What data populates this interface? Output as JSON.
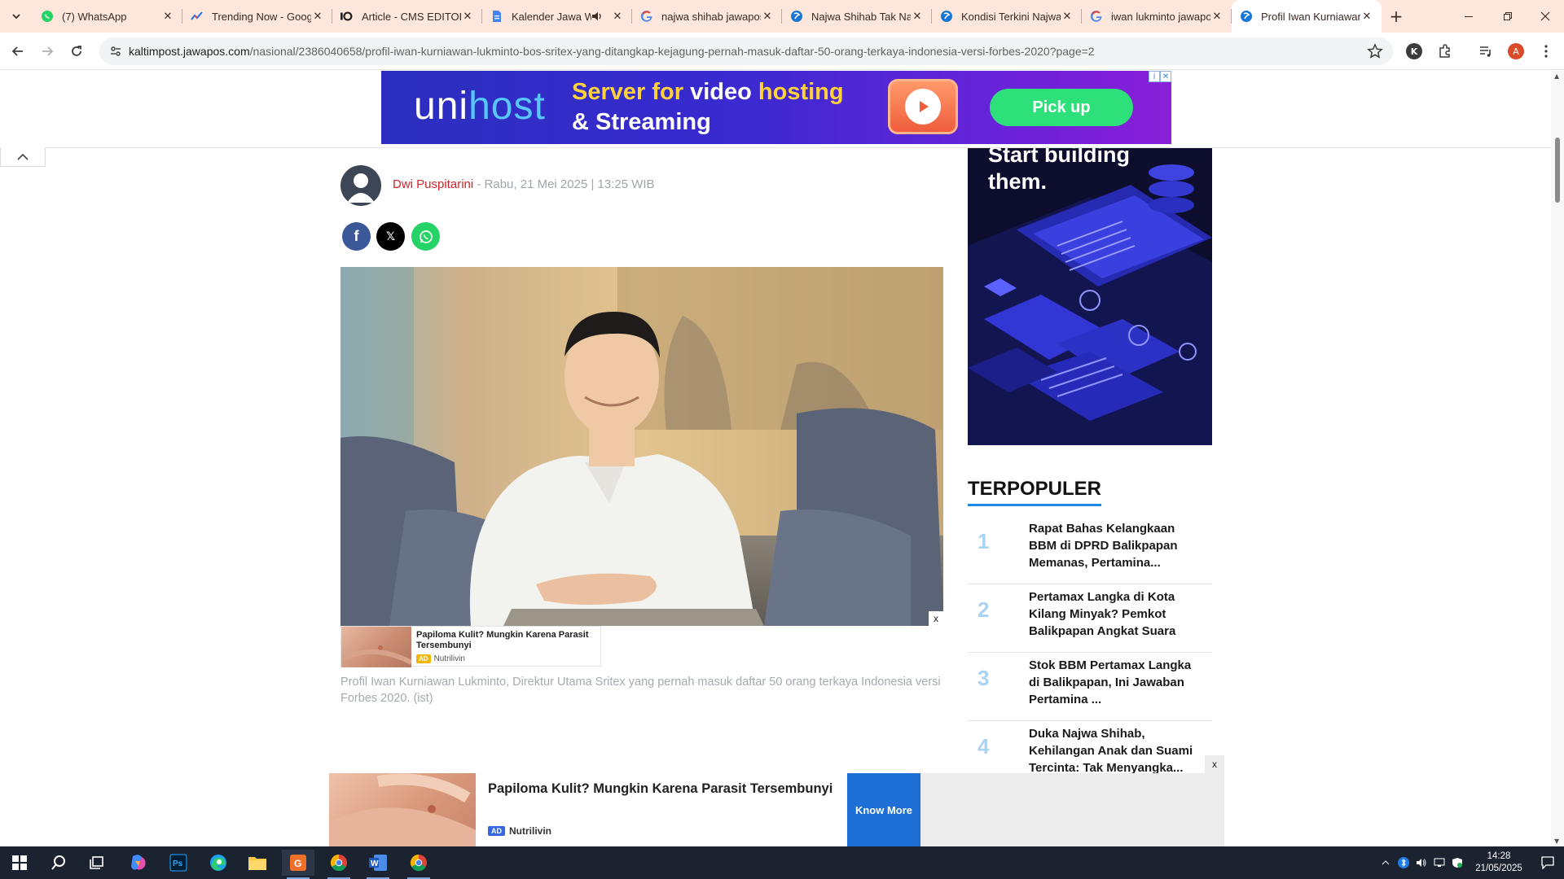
{
  "browser": {
    "tabs": [
      {
        "title": "(7) WhatsApp",
        "icon": "whatsapp-icon"
      },
      {
        "title": "Trending Now - Google Trends",
        "icon": "trends-icon"
      },
      {
        "title": "Article - CMS EDITOR",
        "icon": "cms-icon"
      },
      {
        "title": "Kalender Jawa Weton",
        "icon": "doc-icon",
        "audio": true
      },
      {
        "title": "najwa shihab jawapos",
        "icon": "google-icon"
      },
      {
        "title": "Najwa Shihab Tak Nanti",
        "icon": "jawapos-icon"
      },
      {
        "title": "Kondisi Terkini Najwa",
        "icon": "jawapos-icon"
      },
      {
        "title": "iwan lukminto jawapos",
        "icon": "google-icon"
      },
      {
        "title": "Profil Iwan Kurniawan",
        "icon": "jawapos-icon",
        "active": true
      }
    ],
    "url_domain": "kaltimpost.jawapos.com",
    "url_path": "/nasional/2386040658/profil-iwan-kurniawan-lukminto-bos-sritex-yang-ditangkap-kejagung-pernah-masuk-daftar-50-orang-terkaya-indonesia-versi-forbes-2020?page=2",
    "profile_k": "K",
    "profile_a": "A"
  },
  "top_ad": {
    "brand_uni": "uni",
    "brand_host": "host",
    "line1_a": "Server for ",
    "line1_b": "video",
    "line1_c": " hosting",
    "line2": "& Streaming",
    "cta": "Pick up",
    "adchoice_info": "i",
    "adchoice_close": "✕"
  },
  "article": {
    "author": "Dwi Puspitarini",
    "date": " - Rabu, 21 Mei 2025 | 13:25 WIB",
    "share": {
      "facebook": "f",
      "x": "𝕏",
      "whatsapp": "whatsapp"
    },
    "hero_close": "x",
    "caption": "Profil Iwan Kurniawan Lukminto, Direktur Utama Sritex yang pernah masuk daftar 50 orang terkaya Indonesia versi Forbes 2020. (ist)"
  },
  "inline_ad": {
    "title": "Papiloma Kulit? Mungkin Karena Parasit Tersembunyi",
    "tag": "AD",
    "advertiser": "Nutrilivin"
  },
  "sidebar": {
    "ad_text": "Start building\nthem.",
    "section_title": "TERPOPULER",
    "popular": [
      {
        "num": "1",
        "title": "Rapat Bahas Kelangkaan BBM di DPRD Balikpapan Memanas, Pertamina..."
      },
      {
        "num": "2",
        "title": "Pertamax Langka di Kota Kilang Minyak? Pemkot Balikpapan Angkat Suara"
      },
      {
        "num": "3",
        "title": "Stok BBM Pertamax Langka di Balikpapan, Ini Jawaban Pertamina ..."
      },
      {
        "num": "4",
        "title": "Duka Najwa Shihab, Kehilangan Anak dan Suami Tercinta: Tak Menyangka..."
      }
    ]
  },
  "bottom_ad": {
    "title": "Papiloma Kulit? Mungkin Karena Parasit Tersembunyi",
    "tag": "AD",
    "advertiser": "Nutrilivin",
    "cta": "Know More",
    "close": "x"
  },
  "taskbar": {
    "time": "14:28",
    "date": "21/05/2025"
  },
  "colors": {
    "tabstrip": "#fde6dc",
    "author": "#d2232a",
    "accent": "#1e88e5",
    "taskbar": "#1b2331"
  }
}
